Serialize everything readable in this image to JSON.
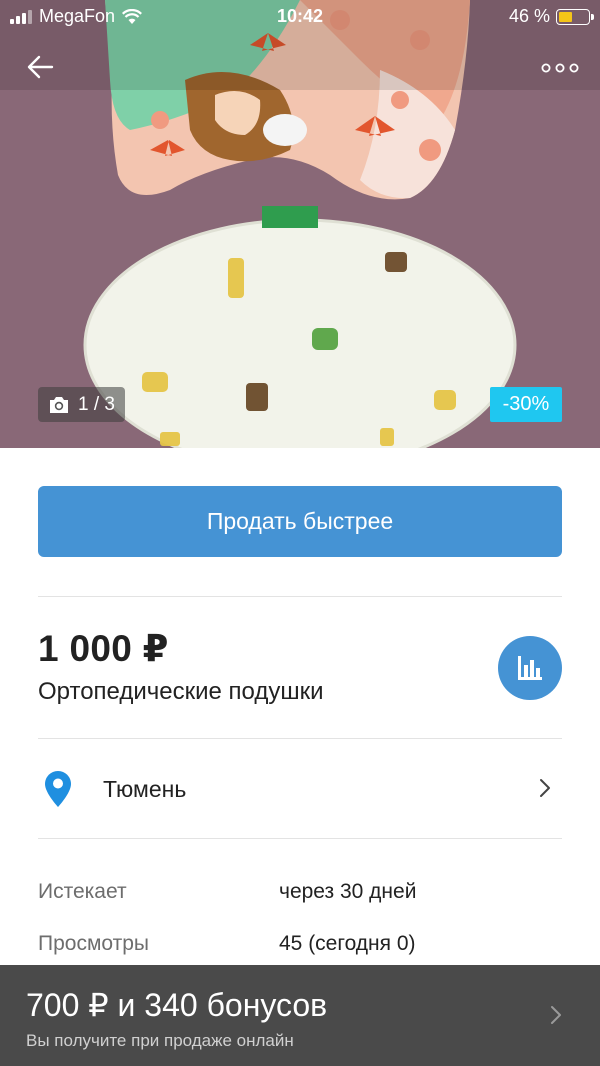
{
  "status_bar": {
    "carrier": "MegaFon",
    "time": "10:42",
    "battery_percent": "46 %",
    "battery_level": 0.46
  },
  "gallery": {
    "counter": "1 / 3",
    "discount_badge": "-30%",
    "discount_color": "#1fc7f0"
  },
  "sell_faster_label": "Продать быстрее",
  "listing": {
    "price": "1 000 ₽",
    "title": "Ортопедические подушки"
  },
  "location": {
    "city": "Тюмень"
  },
  "details": [
    {
      "key": "Истекает",
      "value": "через 30 дней"
    },
    {
      "key": "Просмотры",
      "value": "45 (сегодня 0)"
    }
  ],
  "bonus_bar": {
    "title": "700 ₽ и 340 бонусов",
    "subtitle": "Вы получите при продаже онлайн"
  },
  "colors": {
    "accent": "#4593d4",
    "pin": "#1f8fe0",
    "bottom_bar": "#4a4a4a"
  },
  "icons": [
    "back-arrow-icon",
    "more-dots-icon",
    "camera-icon",
    "bar-chart-icon",
    "location-pin-icon",
    "chevron-right-icon"
  ]
}
